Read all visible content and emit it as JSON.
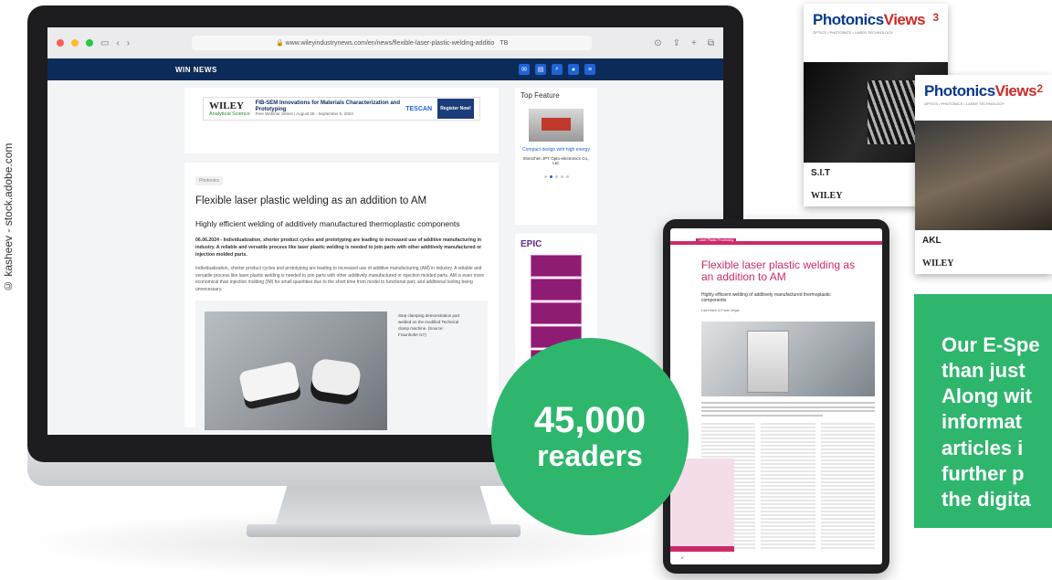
{
  "credit": "© kasheev - stock.adobe.com",
  "browser": {
    "url": "www.wileyindustrynews.com/en/news/flexible-laser-plastic-welding-additio",
    "zoom_text": "TB"
  },
  "site": {
    "logo": "WIN NEWS"
  },
  "ad": {
    "brand": "WILEY",
    "analytical": "Analytical Science",
    "headline": "FIB-SEM Innovations for Materials Characterization and Prototyping",
    "sub": "Free Webinar Series | August 28 - September 5, 2024",
    "sponsor": "TESCAN",
    "cta": "Register Now!"
  },
  "article": {
    "tag": "Photonics",
    "title": "Flexible laser plastic welding as an addition to AM",
    "subtitle": "Highly efficient welding of additively manufactured thermoplastic components",
    "lead": "06.06.2024 - Individualization, shorter product cycles and prototyping are leading to increased use of additive manufacturing in industry. A reliable and versatile process like laser plastic welding is needed to join parts with other additively manufactured or injection molded parts.",
    "body": "Individualization, shorter product cycles and prototyping are leading to increased use of additive manufacturing (AM) in industry. A reliable and versatile process like laser plastic welding is needed to join parts with other additively manufactured or injection molded parts. AM is even more economical than injection molding (IM) for small quantities due to the short time from model to functional part, and additional tooling being unnecessary.",
    "caption": "Step clamping demonstration part welded on the modified Technical clamp machine. (Source: Fraunhofer ILT)"
  },
  "sidebar": {
    "top_feature": "Top Feature",
    "link": "Compact design with high energy",
    "company": "Shenzhen JPT Opto-electronics Co., Ltd.",
    "epic": "EPIC"
  },
  "magazines": [
    {
      "brand": "Photonics",
      "brand2": "Views",
      "tagline": "OPTICS • PHOTONICS • LASER TECHNOLOGY",
      "issue": "3",
      "footer_brand": "S.I.T",
      "publisher": "WILEY"
    },
    {
      "brand": "Photonics",
      "brand2": "Views",
      "tagline": "OPTICS • PHOTONICS • LASER TECHNOLOGY",
      "issue": "2",
      "footer_brand": "AKL",
      "publisher": "WILEY"
    }
  ],
  "tablet": {
    "section": "Laser Plastic Processing",
    "title": "Flexible laser plastic welding as an addition to AM",
    "subtitle": "Highly efficient welding of additively manufactured thermoplastic components",
    "author": "Lisa Kesch & Frank Geiger",
    "page": "2"
  },
  "readers": {
    "count": "45,000",
    "label": "readers"
  },
  "promo": {
    "lines": [
      "Our E-Spe",
      "than just",
      "Along wit",
      "informat",
      "articles i",
      "further p",
      "the digita"
    ]
  },
  "colors": {
    "green": "#2eb66d",
    "navy": "#0d2b58",
    "magenta": "#cc2a6b"
  }
}
